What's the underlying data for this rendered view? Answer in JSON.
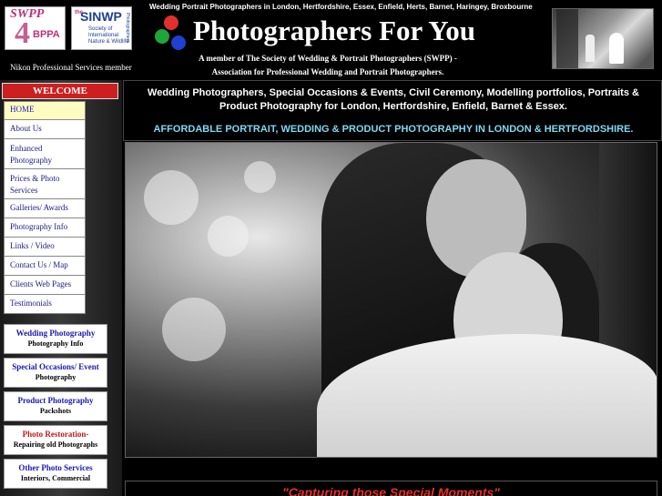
{
  "header": {
    "tagline": "Wedding Portrait Photographers in London, Hertfordshire, Essex, Enfield, Herts, Barnet, Haringey, Broxbourne",
    "site_title": "Photographers For You",
    "member_line1": "A member of The Society of Wedding & Portrait Photographers (SWPP) -",
    "member_line2": "Association for Professional Wedding and Portrait Photographers.",
    "nikon": "Nikon Professional Services member",
    "logo_swpp": {
      "line1": "SWPP",
      "line2": "BPPA",
      "numeral": "4"
    },
    "logo_sinwp": {
      "prefix": "the",
      "name": "SINWP",
      "sub": "Society of International Nature & Wildlife",
      "side": "Photographers"
    },
    "dot_colors": [
      "#e03030",
      "#1fa53a",
      "#2040d0"
    ]
  },
  "sidebar": {
    "welcome": "WELCOME",
    "nav": [
      {
        "label": "HOME",
        "active": true
      },
      {
        "label": "About Us"
      },
      {
        "label": "Enhanced Photography"
      },
      {
        "label": "Prices & Photo Services"
      },
      {
        "label": "Galleries/ Awards"
      },
      {
        "label": "Photography Info"
      },
      {
        "label": "Links / Video"
      },
      {
        "label": "Contact Us / Map"
      },
      {
        "label": "Clients Web Pages"
      },
      {
        "label": "Testimonials"
      }
    ],
    "categories": [
      {
        "title": "Wedding Photography",
        "sub": "Photography Info"
      },
      {
        "title": "Special Occasions/ Event",
        "sub": "Photography"
      },
      {
        "title": "Product Photography",
        "sub": "Packshots"
      },
      {
        "title": "Photo Restoration-",
        "sub": "Repairing old Photographs"
      },
      {
        "title": "Other Photo Services",
        "sub": "Interiors, Commercial"
      }
    ]
  },
  "main": {
    "intro": "Wedding Photographers, Special Occasions & Events, Civil Ceremony, Modelling portfolios, Portraits & Product Photography for London, Hertfordshire, Enfield, Barnet & Essex.",
    "affordable": "AFFORDABLE PORTRAIT, WEDDING & PRODUCT PHOTOGRAPHY IN LONDON & HERTFORDSHIRE.",
    "quote": "\"Capturing those Special Moments\""
  },
  "colors": {
    "welcome_bg": "#cc2020",
    "nav_active_bg": "#fefcc0",
    "affordable_text": "#7fd8f0",
    "quote_text": "#e03030"
  }
}
